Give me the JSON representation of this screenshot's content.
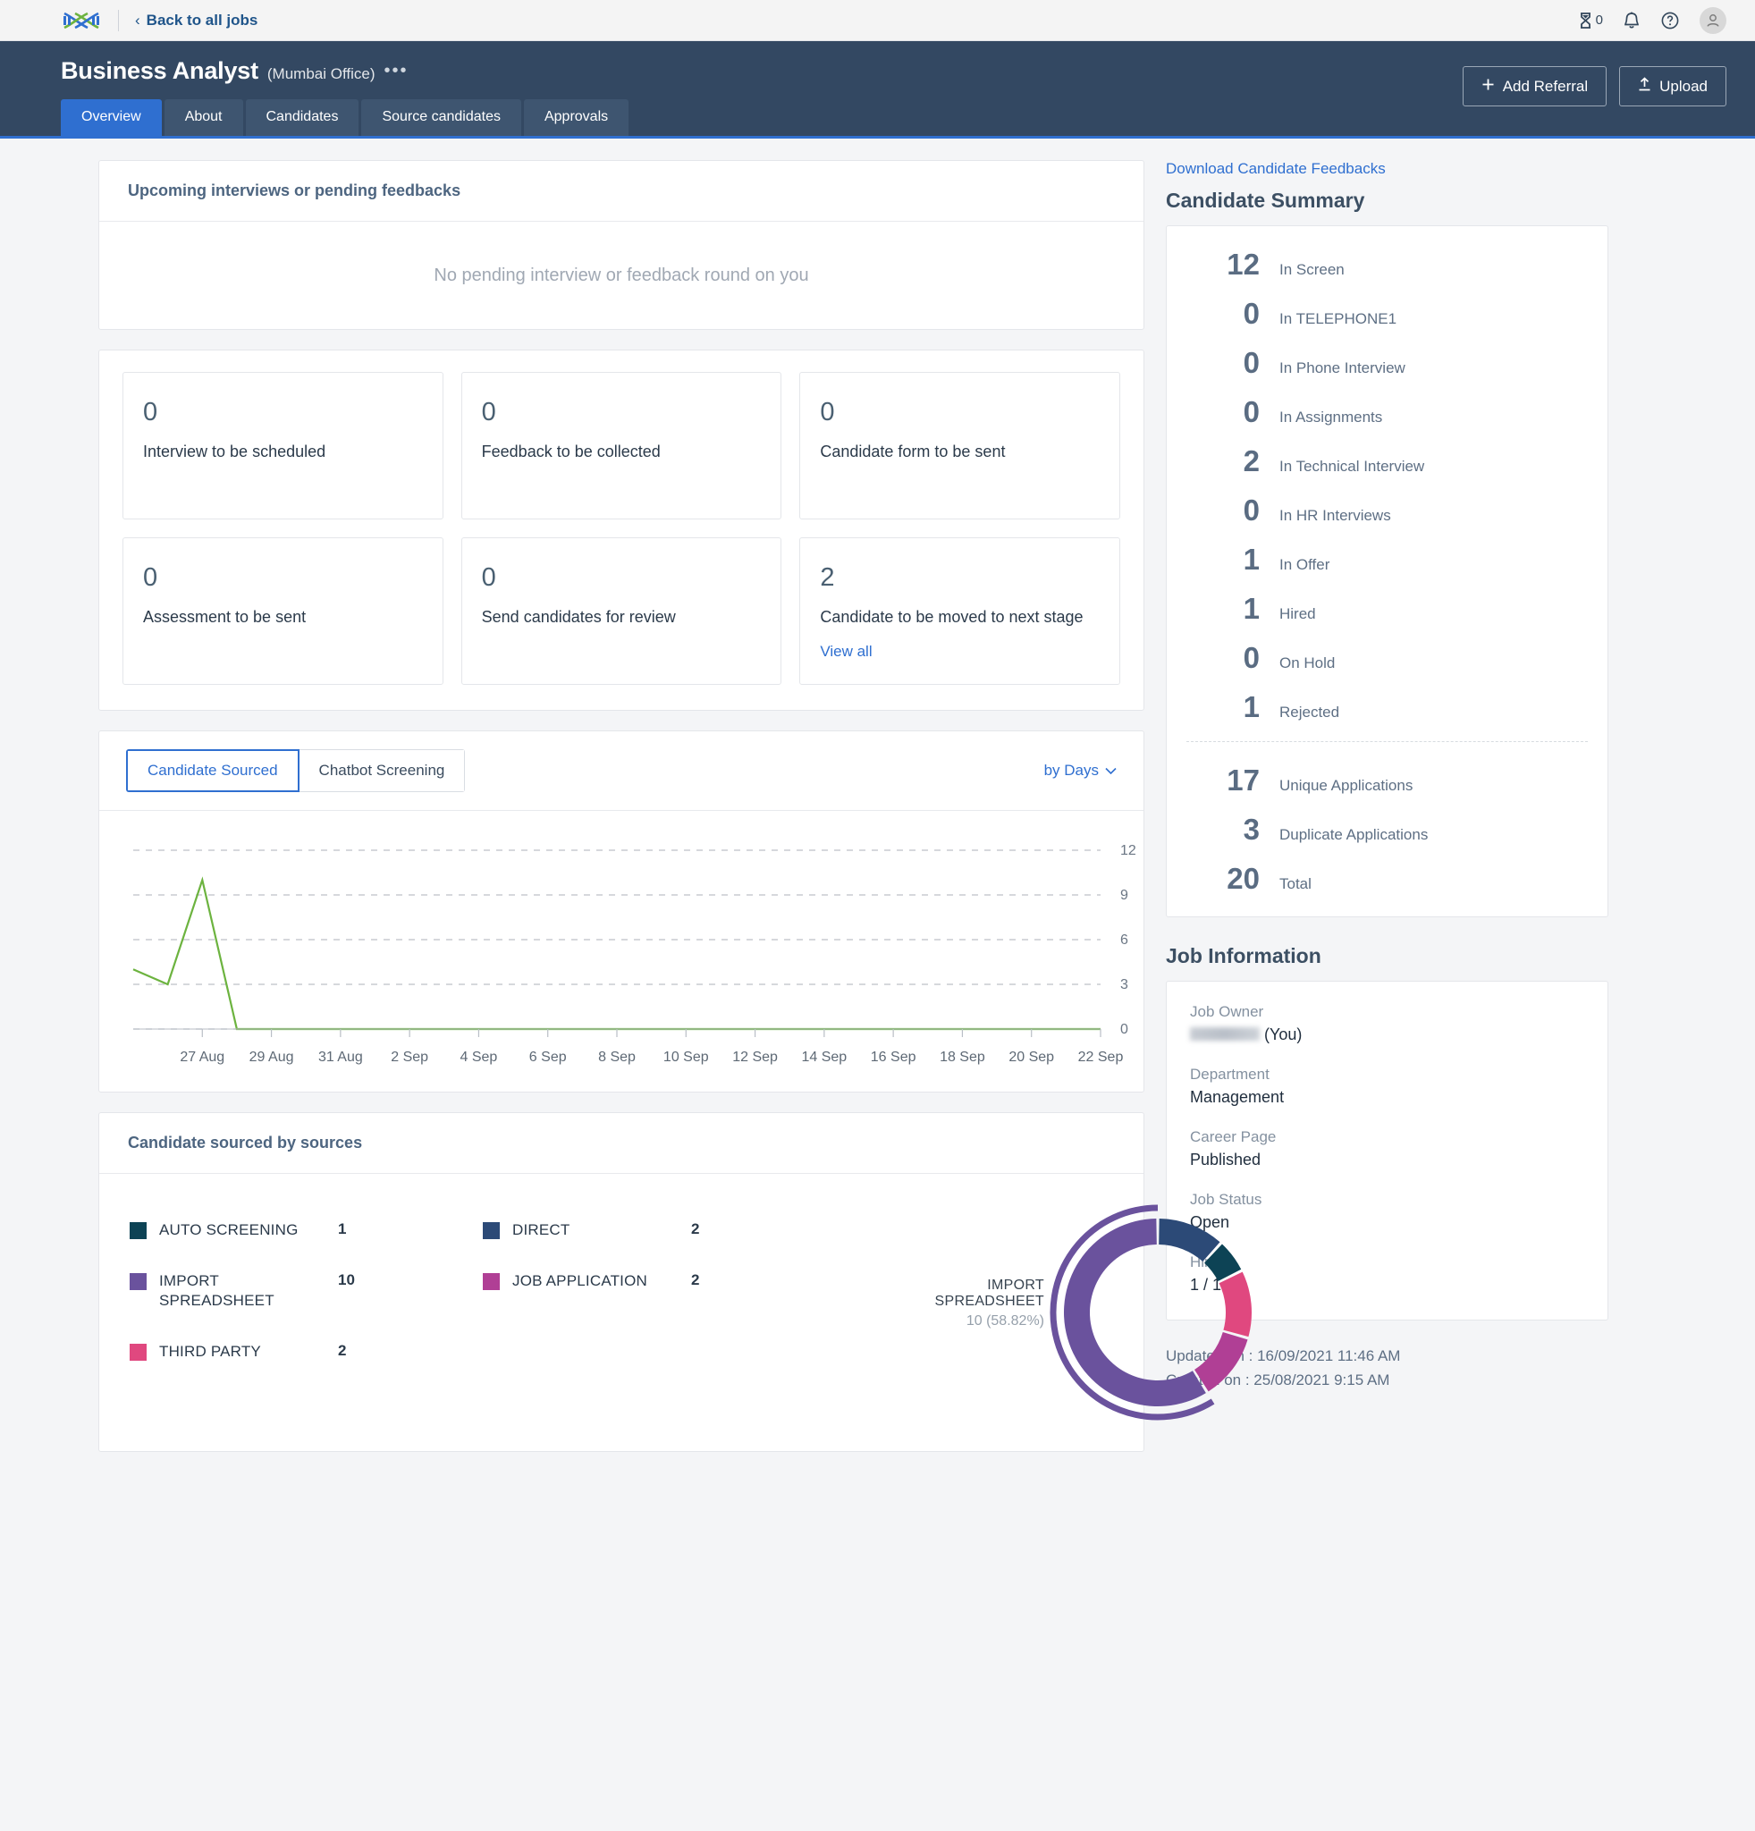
{
  "topbar": {
    "logo_icon": "dna-logo-icon",
    "back_label": "Back to all jobs",
    "back_chevron": "‹",
    "hourglass_icon": "hourglass-icon",
    "hourglass_count": "0",
    "bell_icon": "bell-icon",
    "help_icon": "help-circle-icon",
    "avatar_icon": "user-avatar-icon"
  },
  "job_header": {
    "title": "Business Analyst",
    "office": "(Mumbai Office)",
    "more_icon": "•••",
    "tabs": [
      {
        "label": "Overview",
        "active": true
      },
      {
        "label": "About",
        "active": false
      },
      {
        "label": "Candidates",
        "active": false
      },
      {
        "label": "Source candidates",
        "active": false
      },
      {
        "label": "Approvals",
        "active": false
      }
    ],
    "add_referral_label": "Add Referral",
    "add_referral_icon": "plus-icon",
    "upload_label": "Upload",
    "upload_icon": "upload-arrow-icon"
  },
  "upcoming": {
    "heading": "Upcoming interviews or pending feedbacks",
    "empty_text": "No pending interview or feedback round on you"
  },
  "stats": [
    {
      "num": "0",
      "label": "Interview to be scheduled",
      "link": ""
    },
    {
      "num": "0",
      "label": "Feedback to be collected",
      "link": ""
    },
    {
      "num": "0",
      "label": "Candidate form to be sent",
      "link": ""
    },
    {
      "num": "0",
      "label": "Assessment to be sent",
      "link": ""
    },
    {
      "num": "0",
      "label": "Send candidates for review",
      "link": ""
    },
    {
      "num": "2",
      "label": "Candidate to be moved to next stage",
      "link": "View all"
    }
  ],
  "sourced_chart": {
    "tab_candidate_sourced": "Candidate Sourced",
    "tab_chatbot_screening": "Chatbot Screening",
    "granularity_label": "by Days",
    "granularity_icon": "chevron-down-icon"
  },
  "sources_card": {
    "heading": "Candidate sourced by sources",
    "legend": [
      {
        "name": "AUTO SCREENING",
        "value": "1",
        "color": "#0d4355"
      },
      {
        "name": "IMPORT SPREADSHEET",
        "value": "10",
        "color": "#6a529d"
      },
      {
        "name": "THIRD PARTY",
        "value": "2",
        "color": "#e0487f"
      },
      {
        "name": "DIRECT",
        "value": "2",
        "color": "#2c4a77"
      },
      {
        "name": "JOB APPLICATION",
        "value": "2",
        "color": "#b03f95"
      }
    ],
    "callout_name": "IMPORT SPREADSHEET",
    "callout_value": "10 (58.82%)"
  },
  "sidebar": {
    "download_link": "Download Candidate Feedbacks",
    "summary_title": "Candidate Summary",
    "summary": [
      {
        "num": "12",
        "label": "In Screen"
      },
      {
        "num": "0",
        "label": "In TELEPHONE1"
      },
      {
        "num": "0",
        "label": "In Phone Interview"
      },
      {
        "num": "0",
        "label": "In Assignments"
      },
      {
        "num": "2",
        "label": "In Technical Interview"
      },
      {
        "num": "0",
        "label": "In HR Interviews"
      },
      {
        "num": "1",
        "label": "In Offer"
      },
      {
        "num": "1",
        "label": "Hired"
      },
      {
        "num": "0",
        "label": "On Hold"
      },
      {
        "num": "1",
        "label": "Rejected"
      }
    ],
    "totals": [
      {
        "num": "17",
        "label": "Unique Applications"
      },
      {
        "num": "3",
        "label": "Duplicate Applications"
      },
      {
        "num": "20",
        "label": "Total"
      }
    ],
    "job_info_title": "Job Information",
    "job_info": [
      {
        "label": "Job Owner",
        "value": "(You)",
        "redacted": true
      },
      {
        "label": "Department",
        "value": "Management",
        "redacted": false
      },
      {
        "label": "Career Page",
        "value": "Published",
        "redacted": false
      },
      {
        "label": "Job Status",
        "value": "Open",
        "redacted": false
      },
      {
        "label": "Hired",
        "value": "1 / 1",
        "redacted": false
      }
    ],
    "updated_on": "Updated on : 16/09/2021 11:46 AM",
    "created_on": "Created on : 25/08/2021 9:15 AM"
  },
  "chart_data": [
    {
      "type": "line",
      "title": "Candidate Sourced",
      "xlabel": "",
      "ylabel": "",
      "ylim": [
        0,
        12
      ],
      "yticks": [
        0,
        3,
        6,
        9,
        12
      ],
      "grid": true,
      "legend": "none",
      "line_color": "#6cb33f",
      "categories": [
        "27 Aug",
        "29 Aug",
        "31 Aug",
        "2 Sep",
        "4 Sep",
        "6 Sep",
        "8 Sep",
        "10 Sep",
        "12 Sep",
        "14 Sep",
        "16 Sep",
        "18 Sep",
        "20 Sep",
        "22 Sep"
      ],
      "x": [
        "25 Aug",
        "26 Aug",
        "27 Aug",
        "28 Aug",
        "29 Aug",
        "30 Aug",
        "31 Aug",
        "1 Sep",
        "2 Sep",
        "3 Sep",
        "4 Sep",
        "5 Sep",
        "6 Sep",
        "7 Sep",
        "8 Sep",
        "9 Sep",
        "10 Sep",
        "11 Sep",
        "12 Sep",
        "13 Sep",
        "14 Sep",
        "15 Sep",
        "16 Sep",
        "17 Sep",
        "18 Sep",
        "19 Sep",
        "20 Sep",
        "21 Sep",
        "22 Sep"
      ],
      "values": [
        4,
        3,
        10,
        0,
        0,
        0,
        0,
        0,
        0,
        0,
        0,
        0,
        0,
        0,
        0,
        0,
        0,
        0,
        0,
        0,
        0,
        0,
        0,
        0,
        0,
        0,
        0,
        0,
        0
      ]
    },
    {
      "type": "pie",
      "title": "Candidate sourced by sources",
      "donut": true,
      "labels": [
        "IMPORT SPREADSHEET",
        "DIRECT",
        "AUTO SCREENING",
        "THIRD PARTY",
        "JOB APPLICATION"
      ],
      "values": [
        10,
        2,
        1,
        2,
        2
      ],
      "percents": [
        "58.82%",
        "11.76%",
        "5.88%",
        "11.76%",
        "11.76%"
      ],
      "colors": [
        "#6a529d",
        "#2c4a77",
        "#0d4355",
        "#e0487f",
        "#b03f95"
      ],
      "total": 17
    }
  ]
}
